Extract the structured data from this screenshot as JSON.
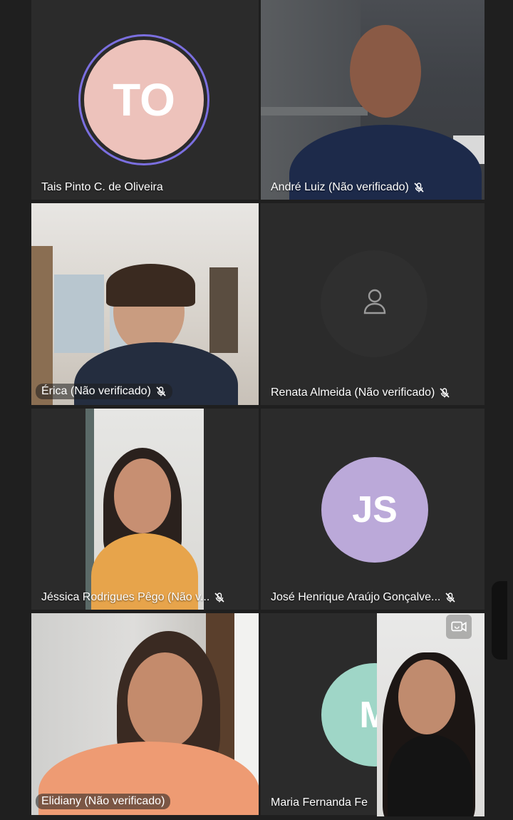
{
  "participants": [
    {
      "id": "tais",
      "name": "Tais Pinto C. de Oliveira",
      "initials": "TO",
      "avatar_color": "#edc2bb",
      "ring_color": "#7b6fe0",
      "muted": false
    },
    {
      "id": "andre",
      "name": "André Luiz (Não verificado)",
      "muted": true
    },
    {
      "id": "erica",
      "name": "Érica  (Não verificado)",
      "muted": true
    },
    {
      "id": "renata",
      "name": "Renata Almeida (Não verificado)",
      "muted": true
    },
    {
      "id": "jessica",
      "name": "Jéssica Rodrigues Pêgo  (Não v...",
      "muted": true
    },
    {
      "id": "jose",
      "name": "José Henrique Araújo Gonçalve...",
      "initials": "JS",
      "avatar_color": "#bba9d9",
      "muted": true
    },
    {
      "id": "elidiany",
      "name": "Elidiany (Não verificado)",
      "muted": false
    },
    {
      "id": "maria",
      "name": "Maria Fernanda Fe",
      "initials": "M",
      "avatar_color": "#9fd6c7",
      "muted": false
    }
  ],
  "icons": {
    "mute": "microphone-off-icon",
    "placeholder_person": "person-icon",
    "switch_camera": "switch-camera-icon"
  }
}
